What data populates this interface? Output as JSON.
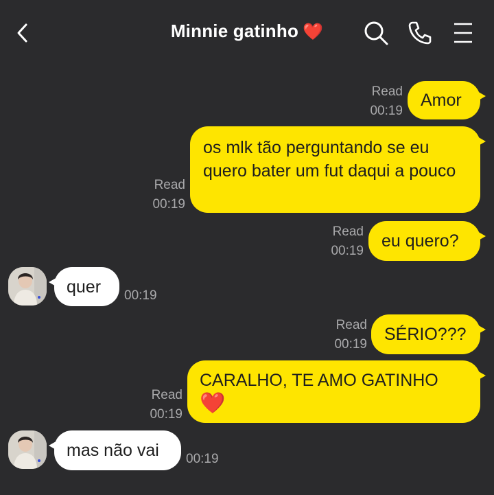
{
  "header": {
    "title": "Minnie gatinho",
    "title_emoji": "❤️"
  },
  "icons": {
    "back": "chevron-left-icon",
    "search": "search-icon",
    "call": "phone-icon",
    "menu": "hamburger-menu-icon"
  },
  "colors": {
    "background": "#2b2b2d",
    "outgoing_bubble": "#fee500",
    "incoming_bubble": "#ffffff",
    "meta_text": "#a9a9ab"
  },
  "messages": [
    {
      "direction": "out",
      "text": "Amor",
      "status": "Read",
      "time": "00:19"
    },
    {
      "direction": "out",
      "text": "os mlk tão perguntando se eu quero bater um fut daqui a pouco",
      "status": "Read",
      "time": "00:19"
    },
    {
      "direction": "out",
      "text": "eu quero?",
      "status": "Read",
      "time": "00:19"
    },
    {
      "direction": "in",
      "text": "quer",
      "time": "00:19"
    },
    {
      "direction": "out",
      "text": "SÉRIO???",
      "status": "Read",
      "time": "00:19"
    },
    {
      "direction": "out",
      "text": "CARALHO, TE AMO GATINHO",
      "emoji": "❤️",
      "status": "Read",
      "time": "00:19"
    },
    {
      "direction": "in",
      "text": "mas não vai",
      "time": "00:19"
    }
  ]
}
